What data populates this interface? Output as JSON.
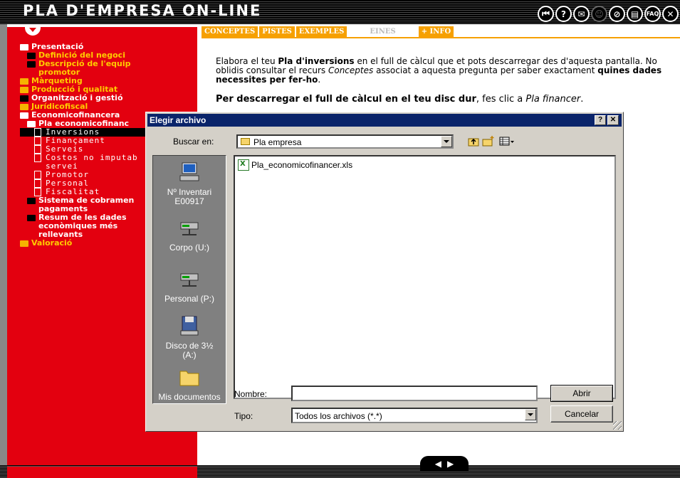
{
  "app": {
    "title": "PLA D'EMPRESA ON-LINE"
  },
  "header": {
    "icons": [
      {
        "name": "home-back-icon",
        "glyph": "⏮"
      },
      {
        "name": "help-icon",
        "glyph": "?"
      },
      {
        "name": "mail-icon",
        "glyph": "✉"
      },
      {
        "name": "user-icon",
        "glyph": "☺",
        "disabled": true
      },
      {
        "name": "attach-icon",
        "glyph": "⊘"
      },
      {
        "name": "notes-icon",
        "glyph": "▤"
      },
      {
        "name": "faq-icon",
        "glyph": "FAQ"
      },
      {
        "name": "exit-icon",
        "glyph": "✕"
      }
    ]
  },
  "tabs": [
    {
      "label": "CONCEPTES"
    },
    {
      "label": "PISTES"
    },
    {
      "label": "EXEMPLES"
    },
    {
      "label": "EINES",
      "disabled": true
    },
    {
      "label": "+ INFO"
    }
  ],
  "sidebar": {
    "items": [
      {
        "label": "Presentació",
        "level": 0,
        "style": "dark",
        "open": true
      },
      {
        "label": "Definició del negoci",
        "level": 1,
        "style": "yellow-dark"
      },
      {
        "label": "Descripció de l'equip",
        "level": 1,
        "style": "yellow-dark"
      },
      {
        "label": "promotor",
        "level": 1,
        "style": "yellow-cont"
      },
      {
        "label": "Màrqueting",
        "level": 0,
        "style": "yellow"
      },
      {
        "label": "Producció i qualitat",
        "level": 0,
        "style": "yellow"
      },
      {
        "label": "Organització i gestió",
        "level": 0,
        "style": "white-dark"
      },
      {
        "label": "Jurídicofiscal",
        "level": 0,
        "style": "yellow"
      },
      {
        "label": "Economicofinancera",
        "level": 0,
        "style": "white",
        "open": true
      },
      {
        "label": "Pla economicofinanc",
        "level": 1,
        "style": "white",
        "open": true
      },
      {
        "label": "Inversions",
        "level": 2,
        "style": "sub",
        "selected": true
      },
      {
        "label": "Finançament",
        "level": 2,
        "style": "sub"
      },
      {
        "label": "Serveis",
        "level": 2,
        "style": "sub"
      },
      {
        "label": "Costos no imputab",
        "level": 2,
        "style": "sub"
      },
      {
        "label": "servei",
        "level": 2,
        "style": "sub-cont"
      },
      {
        "label": "Promotor",
        "level": 2,
        "style": "sub"
      },
      {
        "label": "Personal",
        "level": 2,
        "style": "sub"
      },
      {
        "label": "Fiscalitat",
        "level": 2,
        "style": "sub"
      },
      {
        "label": "Sistema de cobramen",
        "level": 1,
        "style": "white-dark"
      },
      {
        "label": "pagaments",
        "level": 1,
        "style": "white-cont"
      },
      {
        "label": "Resum de les dades",
        "level": 1,
        "style": "white-dark"
      },
      {
        "label": "econòmiques més",
        "level": 1,
        "style": "white-cont"
      },
      {
        "label": "rellevants",
        "level": 1,
        "style": "white-cont"
      },
      {
        "label": "Valoració",
        "level": 0,
        "style": "yellow"
      }
    ]
  },
  "content": {
    "para1": {
      "t1": "Elabora el teu ",
      "b1": "Pla d'inversions",
      "t2": " en el full de càlcul que et pots descarregar des d'aquesta pantalla. No oblidis consultar el recurs ",
      "i1": "Conceptes",
      "t3": " associat a aquesta pregunta per saber exactament ",
      "b2": "quines dades necessites per fer-ho",
      "t4": "."
    },
    "para2": {
      "b1": "Per descarregar el full de càlcul en el teu disc dur",
      "t1": ", fes clic a ",
      "i1": "Pla financer",
      "t2": "."
    }
  },
  "dialog": {
    "title": "Elegir archivo",
    "help_label": "?",
    "close_label": "✕",
    "look_in_label": "Buscar en:",
    "look_in_value": "Pla empresa",
    "places": [
      {
        "label": "Nº Inventari",
        "label2": "E00917",
        "icon": "computer-icon"
      },
      {
        "label": "Corpo (U:)",
        "icon": "network-drive-icon"
      },
      {
        "label": "Personal (P:)",
        "icon": "network-drive-icon"
      },
      {
        "label": "Disco de 3½",
        "label2": "(A:)",
        "icon": "floppy-icon"
      },
      {
        "label": "Mis documentos",
        "icon": "folder-icon"
      }
    ],
    "files": [
      {
        "name": "Pla_economicofinancer.xls",
        "icon": "excel-file-icon"
      }
    ],
    "name_label": "Nombre:",
    "name_value": "",
    "type_label": "Tipo:",
    "type_value": "Todos los archivos (*.*)",
    "open_label": "Abrir",
    "cancel_label": "Cancelar"
  },
  "footer": {
    "prev_glyph": "◀",
    "next_glyph": "▶"
  },
  "colors": {
    "sidebar_red": "#e3000f",
    "tab_orange": "#f6a000",
    "title_blue": "#0a246a",
    "dialog_gray": "#d4d0c8"
  }
}
